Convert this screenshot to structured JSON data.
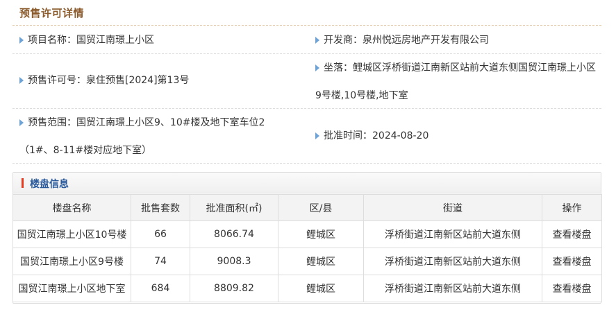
{
  "page": {
    "title": "预售许可详情"
  },
  "details": {
    "project_name_label": "项目名称：",
    "project_name": "国贸江南璟上小区",
    "developer_label": "开发商：",
    "developer": "泉州悦远房地产开发有限公司",
    "permit_no_label": "预售许可号：",
    "permit_no": "泉住预售[2024]第13号",
    "location_label": "坐落：",
    "location": "鲤城区浮桥街道江南新区站前大道东侧国贸江南璟上小区9号楼,10号楼,地下室",
    "scope_label": "预售范围：",
    "scope": "国贸江南璟上小区9、10#楼及地下室车位2（1#、8-11#楼对应地下室）",
    "approval_label": "批准时间：",
    "approval_date": "2024-08-20"
  },
  "buildings": {
    "title": "楼盘信息",
    "columns": [
      "楼盘名称",
      "批售套数",
      "批准面积(㎡)",
      "区/县",
      "街道",
      "操作"
    ],
    "rows": [
      {
        "name": "国贸江南璟上小区10号楼",
        "units": "66",
        "area": "8066.74",
        "district": "鲤城区",
        "street": "浮桥街道江南新区站前大道东侧",
        "action": "查看楼盘"
      },
      {
        "name": "国贸江南璟上小区9号楼",
        "units": "74",
        "area": "9008.3",
        "district": "鲤城区",
        "street": "浮桥街道江南新区站前大道东侧",
        "action": "查看楼盘"
      },
      {
        "name": "国贸江南璟上小区地下室",
        "units": "684",
        "area": "8809.82",
        "district": "鲤城区",
        "street": "浮桥街道江南新区站前大道东侧",
        "action": "查看楼盘"
      }
    ]
  }
}
